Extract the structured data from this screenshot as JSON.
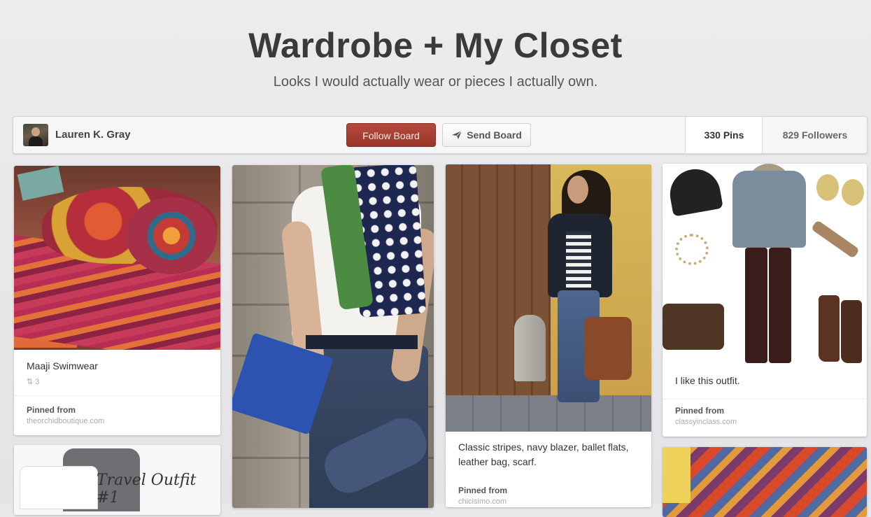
{
  "board": {
    "title": "Wardrobe + My Closet",
    "description": "Looks I would actually wear or pieces I actually own."
  },
  "owner": {
    "name": "Lauren K. Gray"
  },
  "actions": {
    "follow_label": "Follow Board",
    "send_label": "Send Board",
    "follow_color": "#a33a2e"
  },
  "stats": {
    "pins": "330 Pins",
    "followers": "829 Followers"
  },
  "pins": [
    {
      "caption": "Maaji Swimwear",
      "repins": "3",
      "repin_icon": "repin-icon",
      "pinned_label": "Pinned from",
      "source": "theorchidboutique.com"
    },
    {
      "caption": "",
      "pinned_label": "",
      "source": ""
    },
    {
      "caption": "Classic stripes, navy blazer, ballet flats, leather bag, scarf.",
      "pinned_label": "Pinned from",
      "source": "chicisimo.com"
    },
    {
      "caption": "I like this outfit.",
      "pinned_label": "Pinned from",
      "source": "classyinclass.com"
    },
    {
      "image_text": "Travel Outfit #1"
    },
    {
      "caption": ""
    }
  ]
}
